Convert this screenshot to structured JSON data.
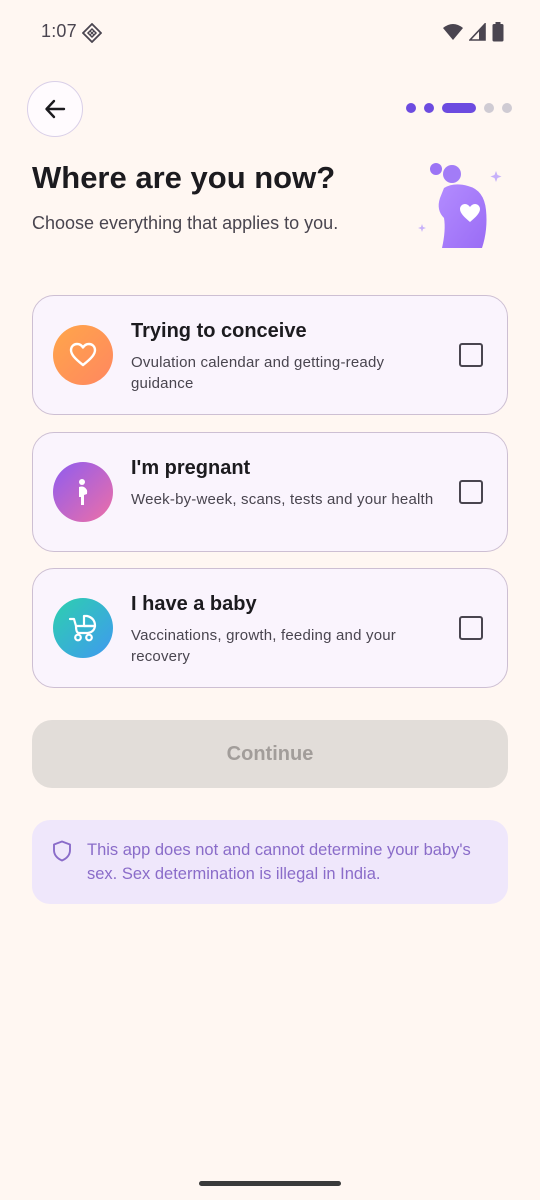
{
  "status_bar": {
    "time": "1:07",
    "app_icon": "app-notification-icon",
    "icons": [
      "wifi-icon",
      "signal-icon",
      "battery-icon"
    ]
  },
  "header": {
    "back_icon": "arrow-left-icon",
    "progress": {
      "total_steps": 5,
      "current_step": 3
    }
  },
  "page": {
    "title": "Where are you now?",
    "subtitle": "Choose everything that applies to you.",
    "illustration": "mother-heart-illustration"
  },
  "options": [
    {
      "title": "Trying to conceive",
      "description": "Ovulation calendar and getting-ready guidance",
      "icon": "heart-icon",
      "checked": false,
      "gradient": [
        "#FFA34E",
        "#FF8A5C"
      ]
    },
    {
      "title": "I'm pregnant",
      "description": "Week-by-week, scans, tests and your health",
      "icon": "pregnant-woman-icon",
      "checked": false,
      "gradient": [
        "#8B5CF6",
        "#EC6FA8"
      ]
    },
    {
      "title": "I have a baby",
      "description": "Vaccinations, growth, feeding and your recovery",
      "icon": "stroller-icon",
      "checked": false,
      "gradient": [
        "#2DCDB0",
        "#3E9BEE"
      ]
    }
  ],
  "continue_button": {
    "label": "Continue",
    "enabled": false
  },
  "notice": {
    "icon": "shield-icon",
    "text": "This app does not and cannot determine your baby's sex. Sex determination is illegal in India."
  },
  "colors": {
    "background": "#FFF7F2",
    "accent": "#6C4BE0",
    "card_background": "#FAF4FD",
    "notice_background": "#EFE7FB",
    "notice_text": "#8A6CC9"
  }
}
